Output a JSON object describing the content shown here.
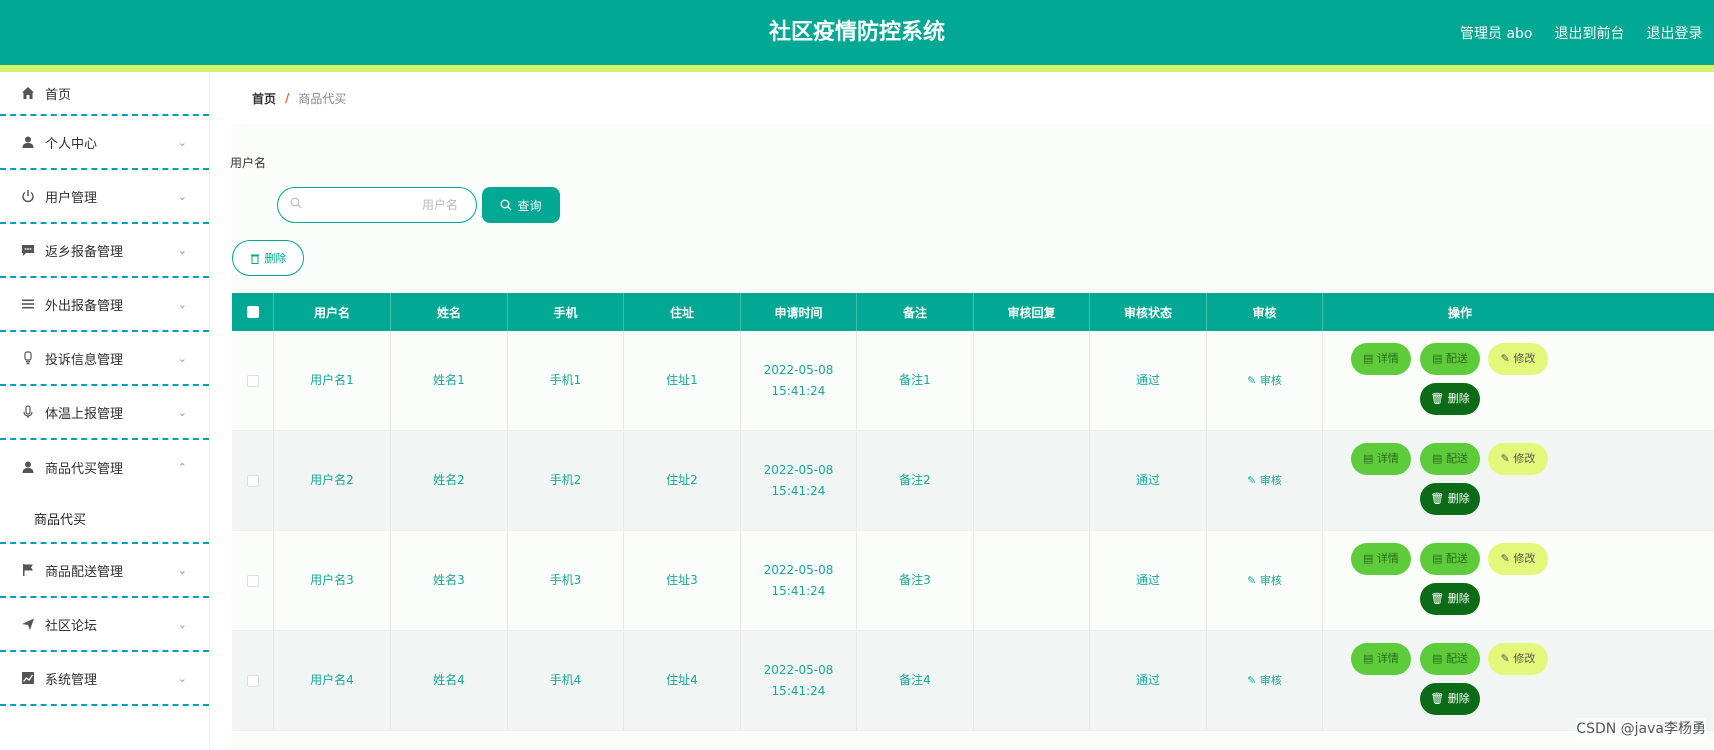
{
  "header": {
    "title": "社区疫情防控系统",
    "admin_label": "管理员 abo",
    "back_to_front": "退出到前台",
    "logout": "退出登录"
  },
  "sidebar": {
    "items": [
      {
        "label": "首页",
        "icon": "home-icon"
      },
      {
        "label": "个人中心",
        "icon": "user-icon"
      },
      {
        "label": "用户管理",
        "icon": "power-icon"
      },
      {
        "label": "返乡报备管理",
        "icon": "chat-icon"
      },
      {
        "label": "外出报备管理",
        "icon": "list-icon"
      },
      {
        "label": "投诉信息管理",
        "icon": "bulb-icon"
      },
      {
        "label": "体温上报管理",
        "icon": "mic-icon"
      },
      {
        "label": "商品代买管理",
        "icon": "user-icon"
      },
      {
        "label": "商品配送管理",
        "icon": "flag-icon"
      },
      {
        "label": "社区论坛",
        "icon": "send-icon"
      },
      {
        "label": "系统管理",
        "icon": "chart-icon"
      }
    ],
    "sub_item": "商品代买"
  },
  "breadcrumb": {
    "home": "首页",
    "sep": "/",
    "current": "商品代买"
  },
  "search": {
    "label": "用户名",
    "placeholder": "用户名",
    "query_button": "查询"
  },
  "toolbar": {
    "delete_button": "删除"
  },
  "table": {
    "columns": [
      "用户名",
      "姓名",
      "手机",
      "住址",
      "申请时间",
      "备注",
      "审核回复",
      "审核状态",
      "审核",
      "操作"
    ],
    "rows": [
      {
        "username": "用户名1",
        "name": "姓名1",
        "phone": "手机1",
        "address": "住址1",
        "time": "2022-05-08 15:41:24",
        "remark": "备注1",
        "reply": "",
        "status": "通过",
        "audit": "审核"
      },
      {
        "username": "用户名2",
        "name": "姓名2",
        "phone": "手机2",
        "address": "住址2",
        "time": "2022-05-08 15:41:24",
        "remark": "备注2",
        "reply": "",
        "status": "通过",
        "audit": "审核"
      },
      {
        "username": "用户名3",
        "name": "姓名3",
        "phone": "手机3",
        "address": "住址3",
        "time": "2022-05-08 15:41:24",
        "remark": "备注3",
        "reply": "",
        "status": "通过",
        "audit": "审核"
      },
      {
        "username": "用户名4",
        "name": "姓名4",
        "phone": "手机4",
        "address": "住址4",
        "time": "2022-05-08 15:41:24",
        "remark": "备注4",
        "reply": "",
        "status": "通过",
        "audit": "审核"
      }
    ],
    "actions": {
      "detail": "详情",
      "deliver": "配送",
      "edit": "修改",
      "delete": "删除"
    }
  },
  "watermark": "CSDN @java李杨勇",
  "colors": {
    "primary": "#01a893",
    "accent_stripe": "#d6f46a",
    "detail_btn": "#5ecb3a",
    "edit_btn": "#e3f87a",
    "delete_btn": "#0b6b16"
  }
}
